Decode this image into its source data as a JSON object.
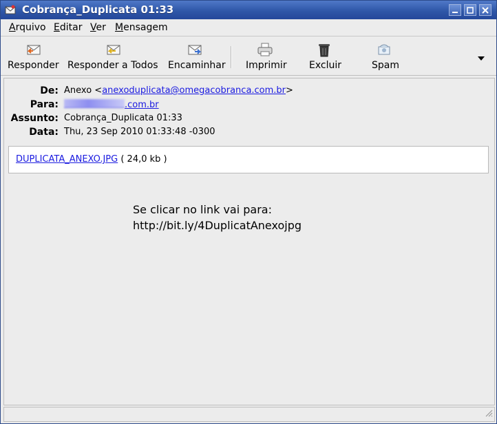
{
  "window": {
    "title": "Cobrança_Duplicata 01:33"
  },
  "menu": {
    "items": [
      {
        "first": "A",
        "rest": "rquivo"
      },
      {
        "first": "E",
        "rest": "ditar"
      },
      {
        "first": "V",
        "rest": "er"
      },
      {
        "first": "M",
        "rest": "ensagem"
      }
    ]
  },
  "toolbar": {
    "reply": "Responder",
    "reply_all": "Responder a Todos",
    "forward": "Encaminhar",
    "print": "Imprimir",
    "delete": "Excluir",
    "spam": "Spam"
  },
  "headers": {
    "from_label": "De:",
    "from_name": "Anexo <",
    "from_email": "anexoduplicata@omegacobranca.com.br",
    "from_close": ">",
    "to_label": "Para:",
    "to_suffix": ".com.br",
    "subject_label": "Assunto:",
    "subject": "Cobrança_Duplicata 01:33",
    "date_label": "Data:",
    "date": "Thu, 23 Sep 2010 01:33:48 -0300"
  },
  "attachment": {
    "filename": "DUPLICATA_ANEXO.JPG",
    "size": " ( 24,0 kb )"
  },
  "body": {
    "line1": "Se clicar no link vai para:",
    "line2": "http://bit.ly/4DuplicatAnexojpg"
  }
}
